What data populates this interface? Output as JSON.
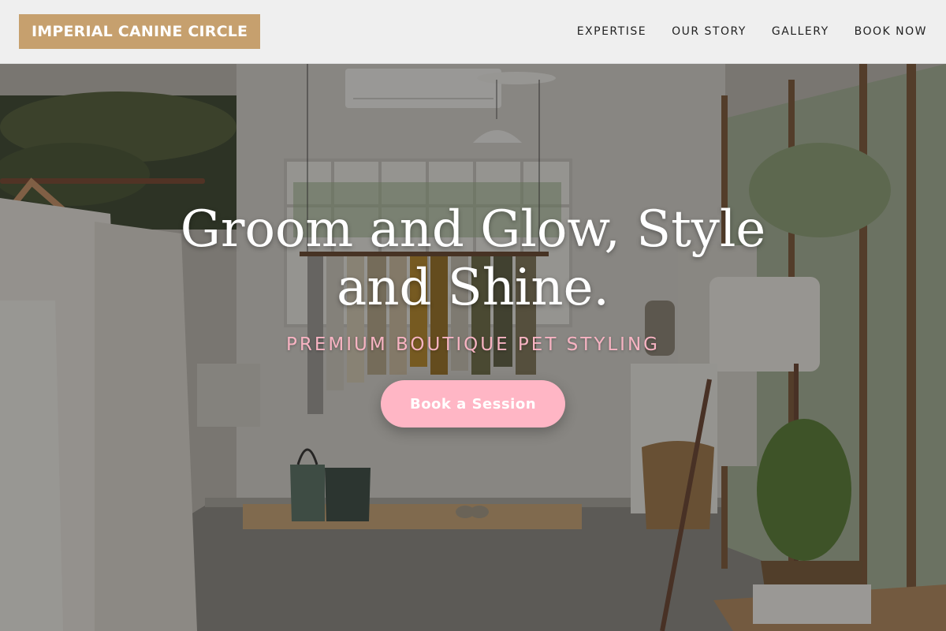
{
  "brand": {
    "name": "IMPERIAL CANINE CIRCLE",
    "color": "#c6a06e"
  },
  "nav": {
    "items": [
      {
        "label": "EXPERTISE"
      },
      {
        "label": "OUR STORY"
      },
      {
        "label": "GALLERY"
      },
      {
        "label": "BOOK NOW"
      }
    ]
  },
  "hero": {
    "headline": "Groom and Glow, Style and Shine.",
    "subtitle": "PREMIUM BOUTIQUE PET STYLING",
    "cta_label": "Book a Session",
    "accent_color": "#ffb6c5",
    "background_image": "boutique-interior-photo"
  }
}
